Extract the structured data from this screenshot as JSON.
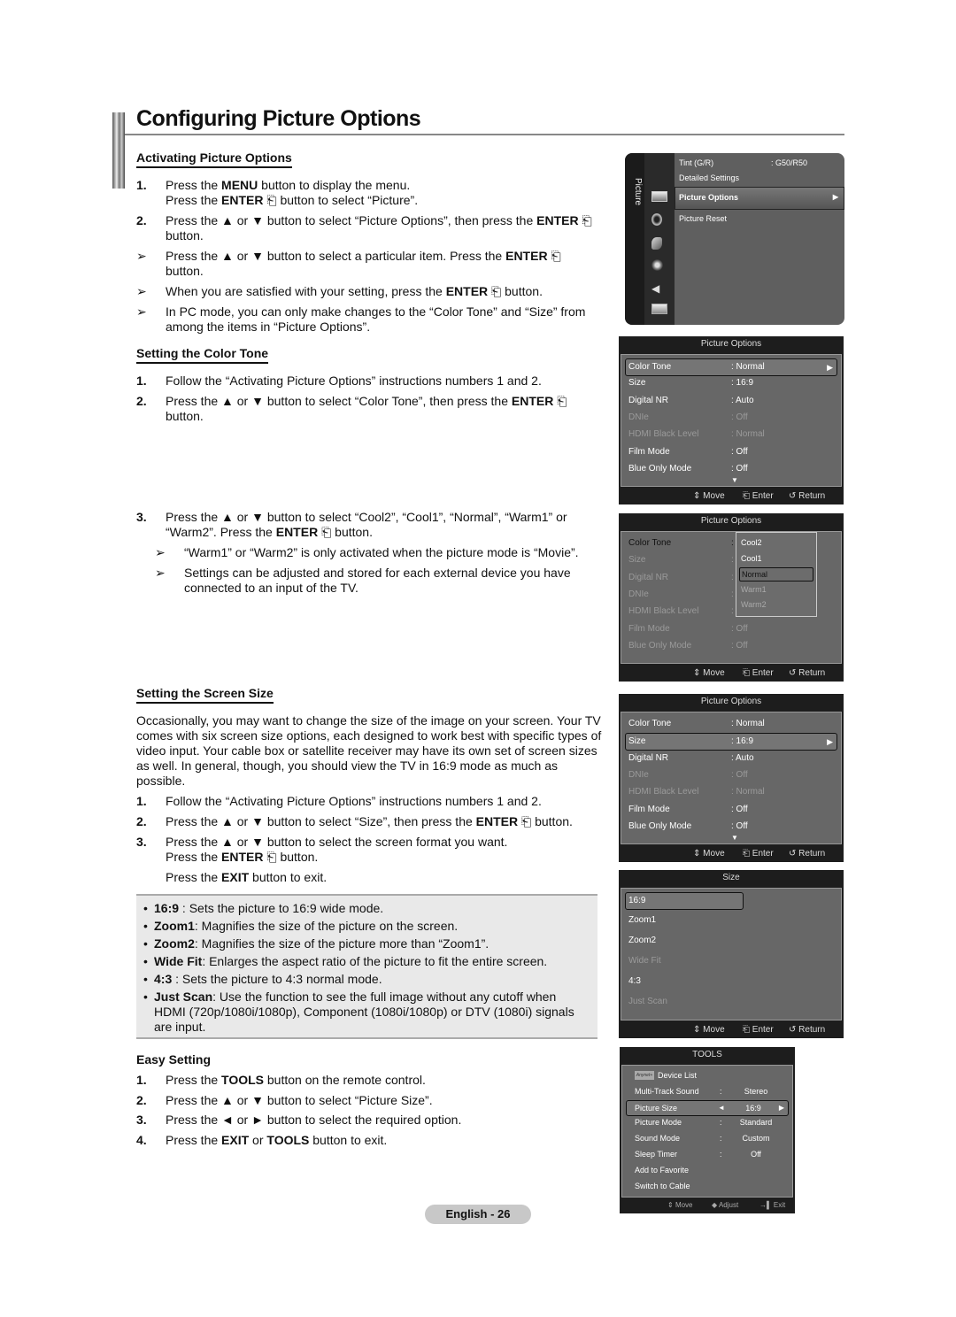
{
  "page": {
    "title": "Configuring Picture Options",
    "page_label": "English - 26"
  },
  "activating": {
    "heading": "Activating Picture Options",
    "steps": [
      {
        "num": "1.",
        "parts": [
          [
            "Press the ",
            false
          ],
          [
            "MENU",
            true
          ],
          [
            " button to display the menu.",
            false
          ]
        ],
        "line2": [
          [
            "Press the ",
            false
          ],
          [
            "ENTER",
            true
          ],
          [
            " ⎗ button to select “Picture”.",
            false
          ]
        ]
      },
      {
        "num": "2.",
        "parts": [
          [
            "Press the ▲ or ▼ button to select “Picture Options”, then press the ",
            false
          ],
          [
            "ENTER",
            true
          ],
          [
            " ⎗ button.",
            false
          ]
        ]
      }
    ],
    "notes": [
      [
        [
          "Press the ▲ or ▼ button to select a particular item. Press the ",
          false
        ],
        [
          "ENTER",
          true
        ],
        [
          " ⎗ button.",
          false
        ]
      ],
      [
        [
          "When you are satisfied with your setting, press the ",
          false
        ],
        [
          "ENTER",
          true
        ],
        [
          " ⎗ button.",
          false
        ]
      ],
      [
        [
          "In PC mode, you can only make changes to the “Color Tone” and “Size” from among the items in “Picture Options”.",
          false
        ]
      ]
    ]
  },
  "color_tone": {
    "heading": "Setting the Color Tone",
    "steps": [
      {
        "num": "1.",
        "parts": [
          [
            "Follow the “Activating Picture Options” instructions numbers 1 and 2.",
            false
          ]
        ]
      },
      {
        "num": "2.",
        "parts": [
          [
            "Press the ▲ or ▼ button to select “Color Tone”, then press the ",
            false
          ],
          [
            "ENTER",
            true
          ],
          [
            " ⎗ button.",
            false
          ]
        ]
      },
      {
        "num": "3.",
        "parts": [
          [
            "Press the ▲ or ▼ button to select “Cool2”, “Cool1”, “Normal”, “Warm1” or “Warm2”. Press the ",
            false
          ],
          [
            "ENTER",
            true
          ],
          [
            " ⎗ button.",
            false
          ]
        ]
      }
    ],
    "notes": [
      [
        [
          "“Warm1” or “Warm2” is only activated when the picture mode is “Movie”.",
          false
        ]
      ],
      [
        [
          "Settings can be adjusted and stored for each external device you have connected to an input of the TV.",
          false
        ]
      ]
    ]
  },
  "screen_size": {
    "heading": "Setting the Screen Size",
    "intro": "Occasionally, you may want to change the size of the image on your screen. Your TV comes with six screen size options, each designed to work best with specific types of video input. Your cable box or satellite receiver may have its own set of screen sizes as well. In general, though, you should view the TV in 16:9 mode as much as possible.",
    "steps": [
      {
        "num": "1.",
        "parts": [
          [
            "Follow the “Activating Picture Options” instructions numbers 1 and 2.",
            false
          ]
        ]
      },
      {
        "num": "2.",
        "parts": [
          [
            "Press the ▲ or ▼ button to select “Size”, then press the ",
            false
          ],
          [
            "ENTER",
            true
          ],
          [
            " ⎗ button.",
            false
          ]
        ]
      },
      {
        "num": "3.",
        "parts": [
          [
            "Press the ▲ or ▼ button to select the screen format you want.",
            false
          ]
        ],
        "line2": [
          [
            "Press the ",
            false
          ],
          [
            "ENTER",
            true
          ],
          [
            " ⎗ button.",
            false
          ]
        ]
      }
    ],
    "exit_line": [
      [
        "Press the ",
        false
      ],
      [
        "EXIT",
        true
      ],
      [
        " button to exit.",
        false
      ]
    ],
    "bullets": [
      [
        [
          "16:9",
          true
        ],
        [
          " : Sets the picture to 16:9 wide mode.",
          false
        ]
      ],
      [
        [
          "Zoom1",
          true
        ],
        [
          ": Magnifies the size of the picture on the screen.",
          false
        ]
      ],
      [
        [
          "Zoom2",
          true
        ],
        [
          ": Magnifies the size of the picture more than “Zoom1”.",
          false
        ]
      ],
      [
        [
          "Wide Fit",
          true
        ],
        [
          ": Enlarges the aspect ratio of the picture to fit the entire screen.",
          false
        ]
      ],
      [
        [
          "4:3",
          true
        ],
        [
          " : Sets the picture to 4:3 normal mode.",
          false
        ]
      ],
      [
        [
          "Just Scan",
          true
        ],
        [
          ": Use the function to see the full image without any cutoff when HDMI (720p/1080i/1080p), Component (1080i/1080p) or DTV (1080i) signals are input.",
          false
        ]
      ]
    ]
  },
  "easy_setting": {
    "heading": "Easy Setting",
    "steps": [
      {
        "num": "1.",
        "parts": [
          [
            "Press the ",
            false
          ],
          [
            "TOOLS",
            true
          ],
          [
            " button on the remote control.",
            false
          ]
        ]
      },
      {
        "num": "2.",
        "parts": [
          [
            "Press the ▲ or ▼ button to select “Picture Size”.",
            false
          ]
        ]
      },
      {
        "num": "3.",
        "parts": [
          [
            "Press the ◄ or ► button to select the required option.",
            false
          ]
        ]
      },
      {
        "num": "4.",
        "parts": [
          [
            "Press the ",
            false
          ],
          [
            "EXIT",
            true
          ],
          [
            " or ",
            false
          ],
          [
            "TOOLS",
            true
          ],
          [
            " button to exit.",
            false
          ]
        ]
      }
    ]
  },
  "osd_main": {
    "side_label": "Picture",
    "icons": [
      "picture-icon",
      "sound-icon",
      "channel-icon",
      "setup-icon",
      "input-icon",
      "application-icon"
    ],
    "items": [
      {
        "label": "Tint (G/R)",
        "value": ": G50/R50"
      },
      {
        "label": "Detailed Settings",
        "value": ""
      },
      {
        "label": "Picture Options",
        "value": "",
        "selected": true
      },
      {
        "label": "Picture Reset",
        "value": ""
      }
    ]
  },
  "osd_footer": {
    "move": "Move",
    "enter": "Enter",
    "return": "Return"
  },
  "osd_po1": {
    "title": "Picture Options",
    "rows": [
      {
        "label": "Color Tone",
        "value": ": Normal",
        "selected": true
      },
      {
        "label": "Size",
        "value": ": 16:9"
      },
      {
        "label": "Digital NR",
        "value": ": Auto"
      },
      {
        "label": "DNIe",
        "value": ": Off",
        "dim": true
      },
      {
        "label": "HDMI Black Level",
        "value": ": Normal",
        "dim": true
      },
      {
        "label": "Film Mode",
        "value": ": Off"
      },
      {
        "label": "Blue Only Mode",
        "value": ": Off"
      }
    ]
  },
  "osd_po2": {
    "title": "Picture Options",
    "rows": [
      {
        "label": "Color Tone",
        "value": ":",
        "dark": true
      },
      {
        "label": "Size",
        "value": ":",
        "dim": true
      },
      {
        "label": "Digital NR",
        "value": ":",
        "dim": true
      },
      {
        "label": "DNIe",
        "value": ":",
        "dim": true
      },
      {
        "label": "HDMI Black Level",
        "value": ":",
        "dim": true
      },
      {
        "label": "Film Mode",
        "value": ": Off",
        "dim": true
      },
      {
        "label": "Blue Only Mode",
        "value": ": Off",
        "dim": true
      }
    ],
    "dropdown": [
      {
        "label": "Cool2"
      },
      {
        "label": "Cool1"
      },
      {
        "label": "Normal",
        "selected": true
      },
      {
        "label": "Warm1",
        "dim": true
      },
      {
        "label": "Warm2",
        "dim": true
      }
    ]
  },
  "osd_po3": {
    "title": "Picture Options",
    "rows": [
      {
        "label": "Color Tone",
        "value": ": Normal"
      },
      {
        "label": "Size",
        "value": ": 16:9",
        "selected": true
      },
      {
        "label": "Digital NR",
        "value": ": Auto"
      },
      {
        "label": "DNIe",
        "value": ": Off",
        "dim": true
      },
      {
        "label": "HDMI Black Level",
        "value": ": Normal",
        "dim": true
      },
      {
        "label": "Film Mode",
        "value": ": Off"
      },
      {
        "label": "Blue Only Mode",
        "value": ": Off"
      }
    ]
  },
  "osd_size": {
    "title": "Size",
    "rows": [
      {
        "label": "16:9",
        "selected": true
      },
      {
        "label": "Zoom1"
      },
      {
        "label": "Zoom2"
      },
      {
        "label": "Wide Fit",
        "dim": true
      },
      {
        "label": "4:3"
      },
      {
        "label": "Just Scan",
        "dim": true
      }
    ]
  },
  "osd_tools": {
    "title": "TOOLS",
    "rows": [
      {
        "label": "Device List",
        "value": "",
        "sep": "",
        "badge": "Anynet+"
      },
      {
        "label": "Multi-Track Sound",
        "sep": ":",
        "value": "Stereo"
      },
      {
        "label": "Picture Size",
        "sep": "◄",
        "value": "16:9",
        "selected": true
      },
      {
        "label": "Picture Mode",
        "sep": ":",
        "value": "Standard"
      },
      {
        "label": "Sound Mode",
        "sep": ":",
        "value": "Custom"
      },
      {
        "label": "Sleep Timer",
        "sep": ":",
        "value": "Off"
      },
      {
        "label": "Add to Favorite",
        "sep": "",
        "value": ""
      },
      {
        "label": "Switch to Cable",
        "sep": "",
        "value": ""
      }
    ],
    "footer": {
      "move": "Move",
      "adjust": "Adjust",
      "exit": "Exit"
    }
  }
}
